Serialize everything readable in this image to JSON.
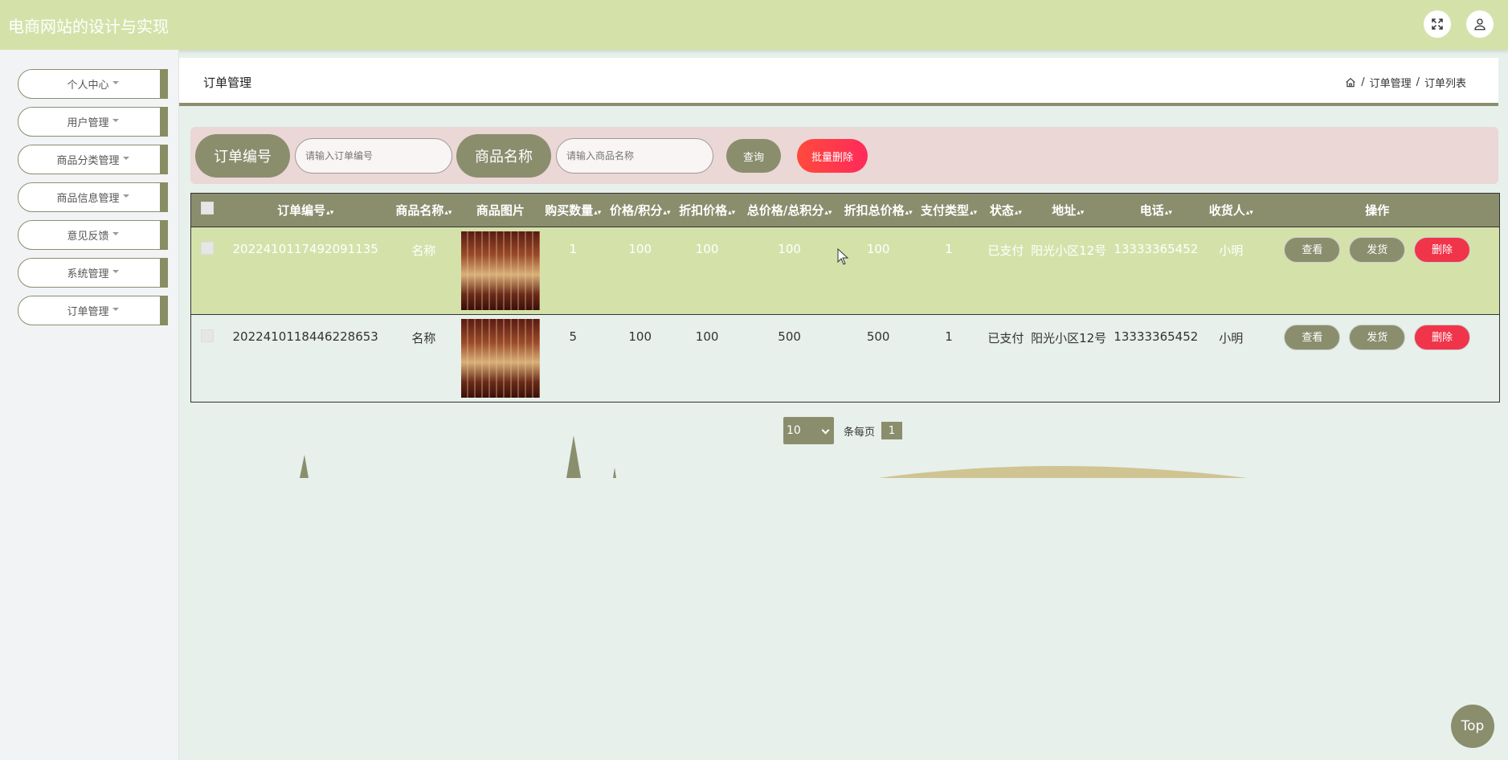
{
  "app": {
    "title": "电商网站的设计与实现"
  },
  "sidebar": {
    "items": [
      {
        "label": "个人中心"
      },
      {
        "label": "用户管理"
      },
      {
        "label": "商品分类管理"
      },
      {
        "label": "商品信息管理"
      },
      {
        "label": "意见反馈"
      },
      {
        "label": "系统管理"
      },
      {
        "label": "订单管理"
      }
    ]
  },
  "page": {
    "title": "订单管理",
    "breadcrumb": [
      "订单管理",
      "订单列表"
    ],
    "breadcrumb_sep": "/"
  },
  "search": {
    "order_no_label": "订单编号",
    "order_no_placeholder": "请输入订单编号",
    "product_name_label": "商品名称",
    "product_name_placeholder": "请输入商品名称",
    "query_label": "查询",
    "batch_delete_label": "批量删除"
  },
  "table": {
    "columns": [
      "订单编号",
      "商品名称",
      "商品图片",
      "购买数量",
      "价格/积分",
      "折扣价格",
      "总价格/总积分",
      "折扣总价格",
      "支付类型",
      "状态",
      "地址",
      "电话",
      "收货人",
      "操作"
    ],
    "rows": [
      {
        "order_no": "2022410117492091135",
        "product": "名称",
        "qty": "1",
        "price": "100",
        "discount_price": "100",
        "total": "100",
        "discount_total": "100",
        "pay_type": "1",
        "status": "已支付",
        "address": "阳光小区12号",
        "phone": "13333365452",
        "receiver": "小明"
      },
      {
        "order_no": "2022410118446228653",
        "product": "名称",
        "qty": "5",
        "price": "100",
        "discount_price": "100",
        "total": "500",
        "discount_total": "500",
        "pay_type": "1",
        "status": "已支付",
        "address": "阳光小区12号",
        "phone": "13333365452",
        "receiver": "小明"
      }
    ],
    "actions": {
      "view": "查看",
      "ship": "发货",
      "delete": "删除"
    }
  },
  "pagination": {
    "page_size": "10",
    "per_page_label": "条每页",
    "current_page": "1"
  },
  "top_button": "Top",
  "colors": {
    "header_bg": "#d4e2aa",
    "accent": "#8a8e6d",
    "danger": "#f0344a",
    "searchbar_bg": "#ead7d6"
  }
}
